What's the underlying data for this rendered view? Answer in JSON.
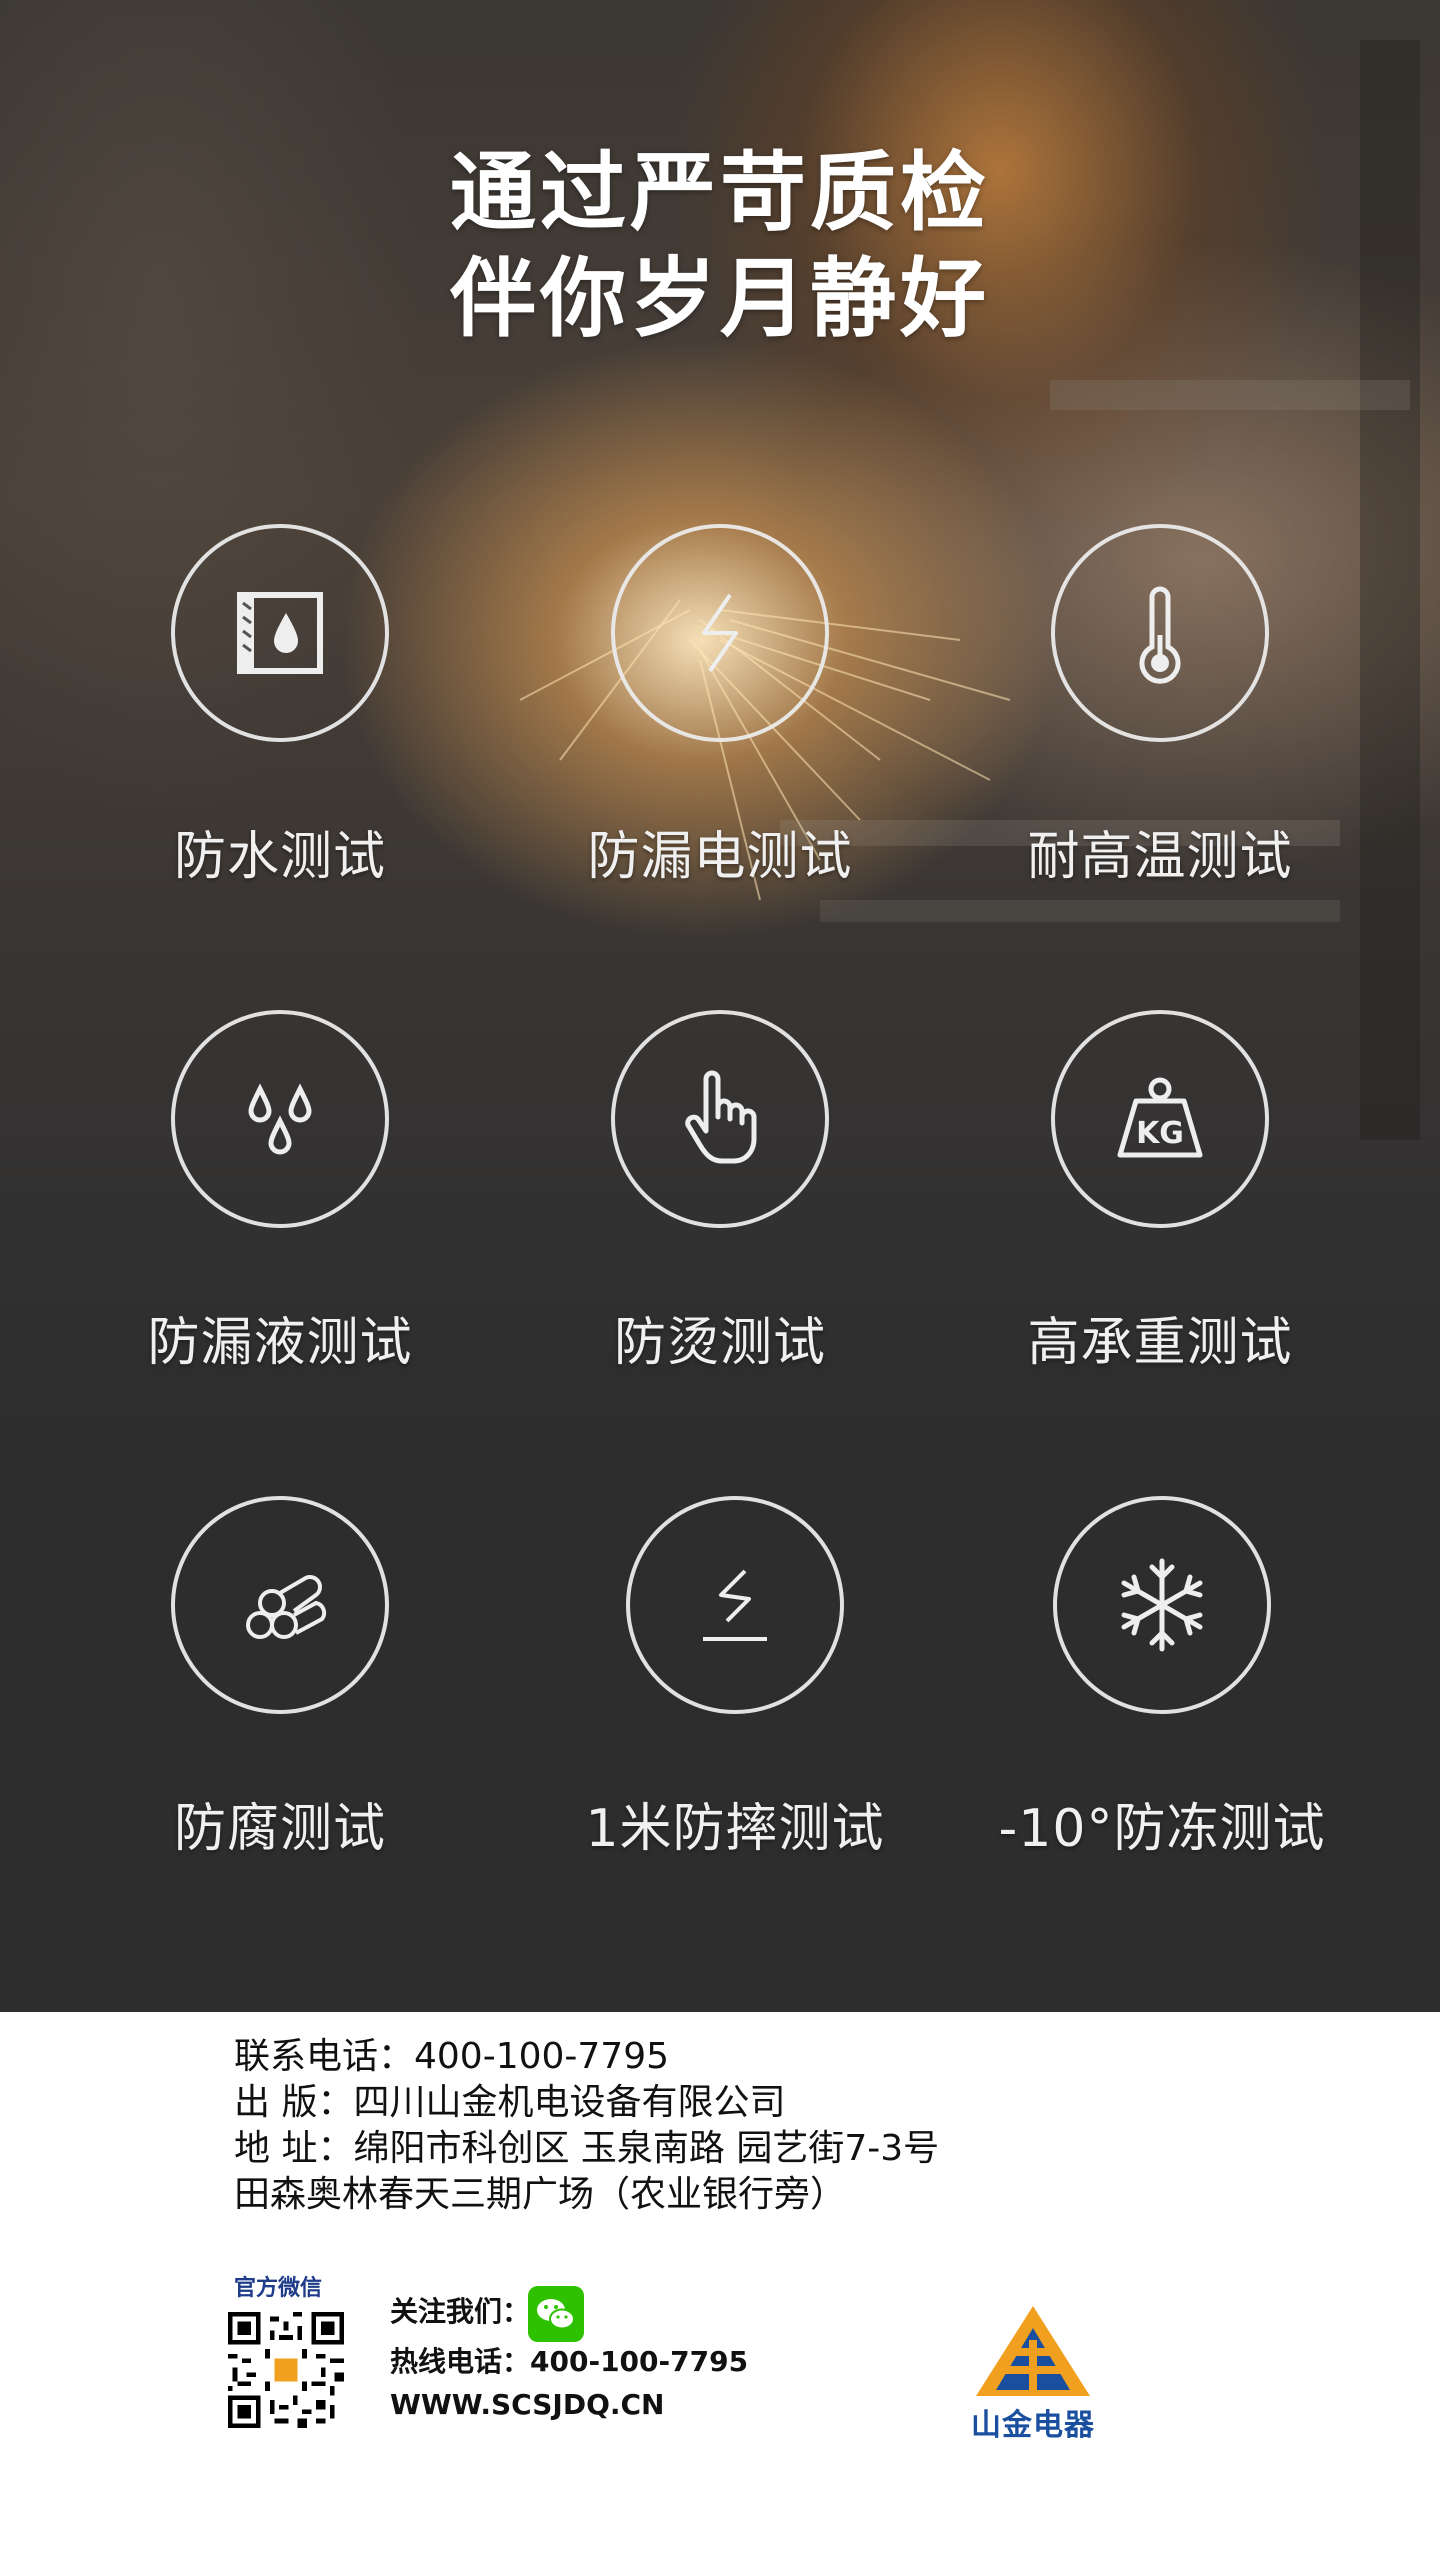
{
  "headline": {
    "line1": "通过严苛质检",
    "line2": "伴你岁月静好"
  },
  "features": [
    {
      "label": "防水测试",
      "icon": "waterproof-icon"
    },
    {
      "label": "防漏电测试",
      "icon": "lightning-icon"
    },
    {
      "label": "耐高温测试",
      "icon": "thermometer-icon"
    },
    {
      "label": "防漏液测试",
      "icon": "droplets-icon"
    },
    {
      "label": "防烫测试",
      "icon": "hand-pointer-icon"
    },
    {
      "label": "高承重测试",
      "icon": "kg-weight-icon"
    },
    {
      "label": "防腐测试",
      "icon": "pipes-icon"
    },
    {
      "label": "1米防摔测试",
      "icon": "drop-test-icon"
    },
    {
      "label": "-10°防冻测试",
      "icon": "snowflake-icon"
    }
  ],
  "info": {
    "phone": "联系电话：400-100-7795",
    "publisher": "出 版：四川山金机电设备有限公司",
    "address1": "地 址：绵阳市科创区 玉泉南路 园艺街7-3号",
    "address2": "田森奥林春天三期广场（农业银行旁）"
  },
  "footer": {
    "wechat_title": "官方微信",
    "follow_label": "关注我们：",
    "hotline": "热线电话：400-100-7795",
    "website": "WWW.SCSJDQ.CN",
    "logo_text": "山金电器",
    "colors": {
      "brand_blue": "#1a4fa0",
      "brand_orange": "#f0a01e",
      "wechat_green": "#2dc100"
    }
  }
}
